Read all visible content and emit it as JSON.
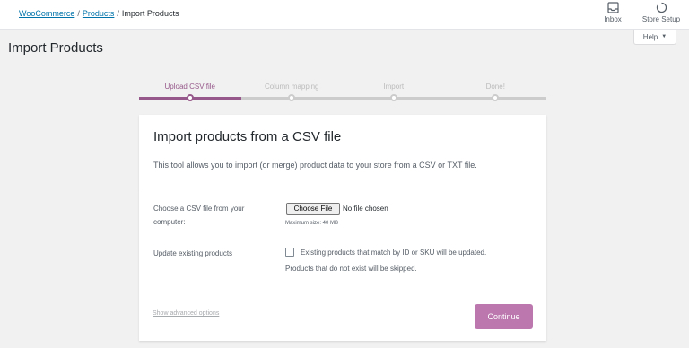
{
  "breadcrumb": {
    "root": "WooCommerce",
    "parent": "Products",
    "current": "Import Products",
    "separator": "/"
  },
  "topbar": {
    "inbox_label": "Inbox",
    "inbox_icon": "inbox-icon",
    "setup_label": "Store Setup",
    "setup_icon": "progress-spinner-icon"
  },
  "help": {
    "label": "Help",
    "caret": "▼"
  },
  "page_title": "Import Products",
  "steps": [
    {
      "label": "Upload CSV file",
      "active": true
    },
    {
      "label": "Column mapping",
      "active": false
    },
    {
      "label": "Import",
      "active": false
    },
    {
      "label": "Done!",
      "active": false
    }
  ],
  "card": {
    "title": "Import products from a CSV file",
    "description": "This tool allows you to import (or merge) product data to your store from a CSV or TXT file.",
    "file_label": "Choose a CSV file from your computer:",
    "file_button": "Choose File",
    "file_status": "No file chosen",
    "max_size": "Maximum size: 40 MB",
    "update_label": "Update existing products",
    "update_checked": false,
    "update_text_1": "Existing products that match by ID or SKU will be updated.",
    "update_text_2": "Products that do not exist will be skipped.",
    "advanced_link": "Show advanced options",
    "continue_button": "Continue"
  },
  "colors": {
    "accent": "#96588a",
    "button": "#bb77ae",
    "link": "#0073aa"
  }
}
